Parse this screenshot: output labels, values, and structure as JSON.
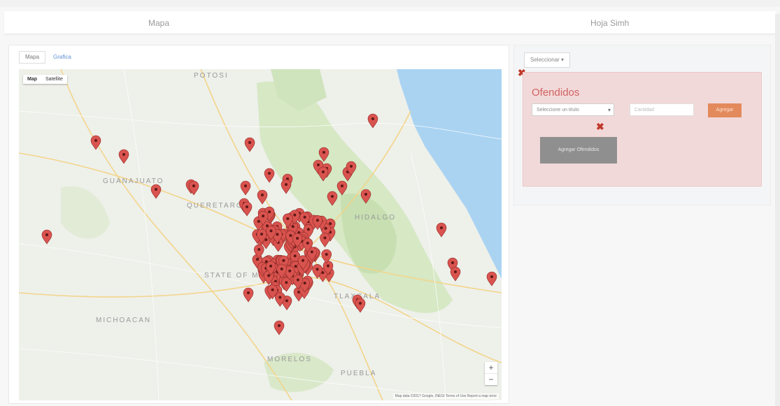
{
  "header": {
    "tab_left": "Mapa",
    "tab_right": "Hoja Simh"
  },
  "map_panel": {
    "toggle": [
      "Mapa",
      "Grafica"
    ],
    "map_type": [
      "Map",
      "Satellite"
    ],
    "zoom_in": "+",
    "zoom_out": "−",
    "attribution": "Map data ©2017 Google, INEGI   Terms of Use   Report a map error",
    "place_labels": {
      "north": "POTOSI",
      "guanajuato": "GUANAJUATO",
      "queretaro": "QUERETARO",
      "hidalgo": "HIDALGO",
      "state_of_mexico": "STATE OF MEXICO",
      "michoacan": "MICHOACAN",
      "tlaxcala": "TLAXCALA",
      "morelos": "MORELOS",
      "puebla": "PUEBLA"
    }
  },
  "side_panel": {
    "dropdown": "Seleccionar ▾",
    "close_icon": "✖",
    "title": "Ofendidos",
    "select_value": "Seleccione un titulo",
    "select_arrow": "▾",
    "text_placeholder": "Cantidad",
    "add_button": "Agregar",
    "remove_icon": "✖",
    "submit_button": "Agregar Ofendidos"
  },
  "colors": {
    "marker": "#d9534f",
    "water": "#aad3f2",
    "forest": "#cfe3bd",
    "offense_bg": "#f2d9d9",
    "accent_orange": "#e38a5c"
  }
}
